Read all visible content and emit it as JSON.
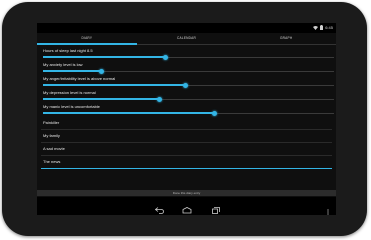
{
  "status_bar": {
    "time": "6:45"
  },
  "tabs": [
    {
      "label": "DIARY",
      "active": true
    },
    {
      "label": "CALENDAR",
      "active": false
    },
    {
      "label": "GRAPH",
      "active": false
    }
  ],
  "sliders": [
    {
      "label": "Hours of sleep last night 8.5",
      "value": 0.42
    },
    {
      "label": "My anxiety level is low",
      "value": 0.2
    },
    {
      "label": "My anger/irritability level is above normal",
      "value": 0.49
    },
    {
      "label": "My depression level is normal",
      "value": 0.4
    },
    {
      "label": "My manic level is uncomfortable",
      "value": 0.59
    }
  ],
  "text_fields": [
    {
      "label": "Painkiller",
      "focused": false
    },
    {
      "label": "My family",
      "focused": false
    },
    {
      "label": "A sad movie",
      "focused": false
    },
    {
      "label": "The news",
      "focused": true
    }
  ],
  "bottom_bar": {
    "label": "Done this diary entry"
  },
  "colors": {
    "accent": "#33b5e5",
    "background": "#0f0f0f"
  }
}
